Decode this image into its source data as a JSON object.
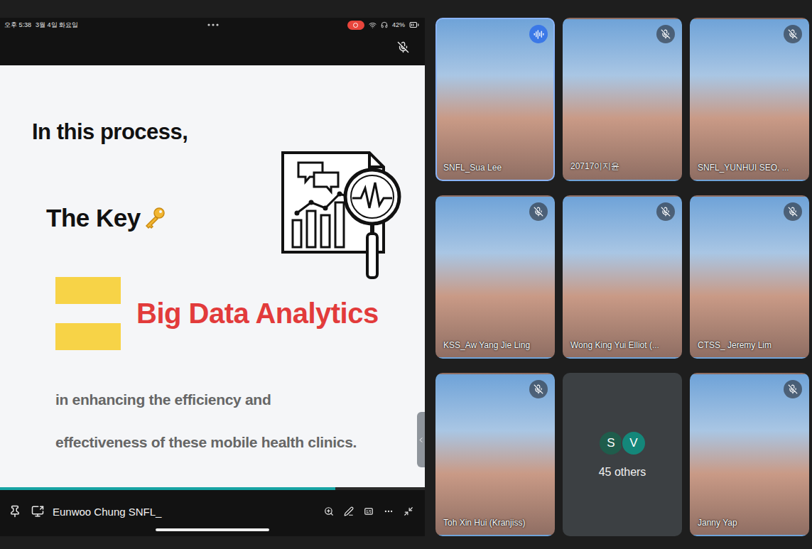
{
  "status_bar": {
    "time": "오후 5:38",
    "date": "3월 4일 화요일",
    "battery": "42%",
    "recording": true
  },
  "shared_screen": {
    "muted": true,
    "presenter": "Eunwoo Chung SNFL_",
    "slide": {
      "heading": "In this process,",
      "key_label": "The Key",
      "highlight": "Big Data Analytics",
      "body": [
        "in enhancing the efficiency and",
        "effectiveness of these mobile health clinics."
      ]
    },
    "progress": {
      "level": 0.79
    }
  },
  "participants": [
    {
      "kind": "video",
      "name": "SNFL_Sua Lee",
      "muted": false,
      "speaking": true
    },
    {
      "kind": "video",
      "name": "20717이지윤",
      "muted": true,
      "speaking": false
    },
    {
      "kind": "video",
      "name": "SNFL_YUNHUI SEO, ...",
      "muted": true,
      "speaking": false
    },
    {
      "kind": "video",
      "name": "KSS_Aw Yang Jie Ling",
      "muted": true,
      "speaking": false
    },
    {
      "kind": "video",
      "name": "Wong King Yui Elliot (...",
      "muted": true,
      "speaking": false
    },
    {
      "kind": "video",
      "name": "CTSS_ Jeremy Lim",
      "muted": true,
      "speaking": false
    },
    {
      "kind": "video",
      "name": "Toh Xin Hui (Kranjiss)",
      "muted": true,
      "speaking": false
    },
    {
      "kind": "others",
      "label": "45 others",
      "avatars": [
        {
          "initial": "S",
          "color": "#1f5d4c"
        },
        {
          "initial": "V",
          "color": "#14877a"
        }
      ]
    },
    {
      "kind": "video",
      "name": "Janny Yap",
      "muted": true,
      "speaking": false
    }
  ]
}
